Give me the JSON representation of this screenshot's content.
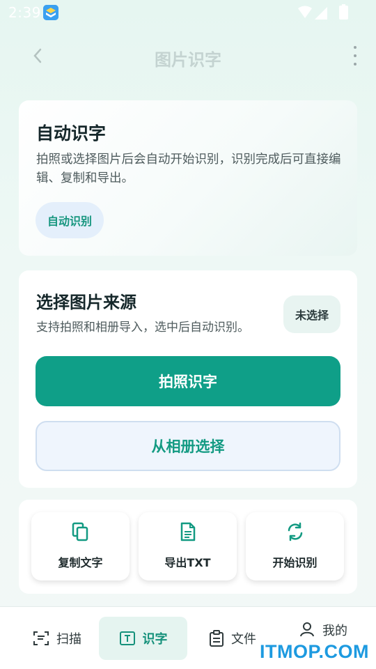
{
  "status_bar": {
    "time": "2:39"
  },
  "header": {
    "title": "图片识字"
  },
  "auto_card": {
    "title": "自动识字",
    "description": "拍照或选择图片后会自动开始识别，识别完成后可直接编辑、复制和导出。",
    "chip": "自动识别"
  },
  "source_card": {
    "title": "选择图片来源",
    "description": "支持拍照和相册导入，选中后自动识别。",
    "status": "未选择",
    "camera_button": "拍照识字",
    "album_button": "从相册选择"
  },
  "actions": [
    {
      "label": "复制文字",
      "icon": "copy-icon"
    },
    {
      "label": "导出TXT",
      "icon": "file-text-icon"
    },
    {
      "label": "开始识别",
      "icon": "refresh-icon"
    }
  ],
  "bottom_nav": [
    {
      "label": "扫描",
      "icon": "scan-icon"
    },
    {
      "label": "识字",
      "icon": "text-recognize-icon"
    },
    {
      "label": "文件",
      "icon": "clipboard-icon"
    },
    {
      "label": "我的",
      "icon": "user-icon"
    }
  ],
  "watermark": "ITMOP.COM",
  "colors": {
    "accent": "#0f9f88",
    "accent_text": "#139a82",
    "secondary_bg": "#eff5fd",
    "title_muted": "#c4d3d1"
  }
}
